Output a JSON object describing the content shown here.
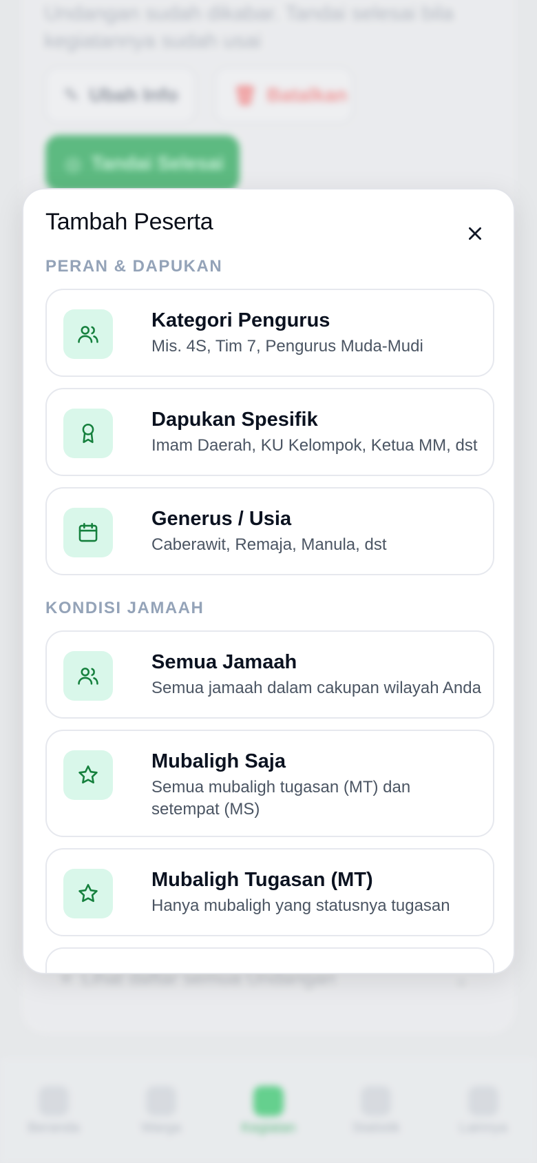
{
  "background": {
    "text_line1": "Undangan sudah dikabar. Tandai selesai bila",
    "text_line2": "kegiatannya sudah usai",
    "edit_label": "Ubah Info",
    "delete_label": "Batalkan",
    "primary_label": "Tandai Selesai",
    "dropdown_label": "Lihat daftar semua Undangan",
    "nav": [
      "Beranda",
      "Warga",
      "Kegiatan",
      "Statistik",
      "Lainnya"
    ],
    "active_nav_index": 2
  },
  "modal": {
    "title": "Tambah Peserta",
    "close_icon": "close-icon",
    "sections": [
      {
        "label": "PERAN & DAPUKAN",
        "options": [
          {
            "title": "Kategori Pengurus",
            "description": "Mis. 4S, Tim 7, Pengurus Muda-Mudi",
            "icon": "users-icon"
          },
          {
            "title": "Dapukan Spesifik",
            "description": "Imam Daerah, KU Kelompok, Ketua MM, dst",
            "icon": "award-icon"
          },
          {
            "title": "Generus / Usia",
            "description": "Caberawit, Remaja, Manula, dst",
            "icon": "calendar-icon"
          }
        ]
      },
      {
        "label": "KONDISI JAMAAH",
        "options": [
          {
            "title": "Semua Jamaah",
            "description": "Semua jamaah dalam cakupan wilayah Anda",
            "icon": "users-icon"
          },
          {
            "title": "Mubaligh Saja",
            "description": "Semua mubaligh tugasan (MT) dan setempat (MS)",
            "icon": "star-icon"
          },
          {
            "title": "Mubaligh Tugasan (MT)",
            "description": "Hanya mubaligh yang statusnya tugasan",
            "icon": "star-icon"
          }
        ]
      }
    ]
  },
  "colors": {
    "accent": "#16a34a",
    "icon_bg": "#d9f7ea",
    "icon_stroke": "#15803d",
    "section_label": "#94a3b8"
  }
}
